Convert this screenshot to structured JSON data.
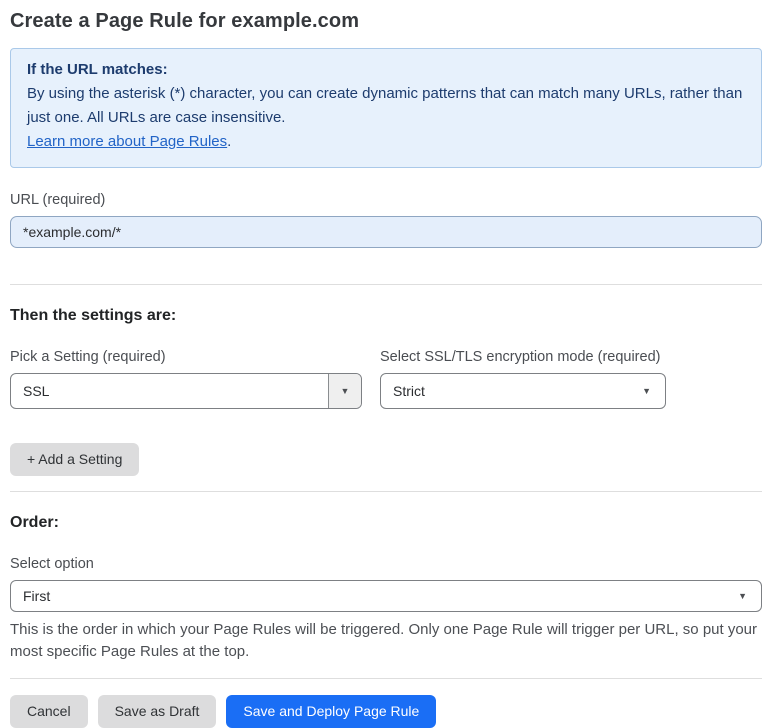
{
  "page": {
    "title": "Create a Page Rule for example.com"
  },
  "info_box": {
    "heading": "If the URL matches:",
    "body": "By using the asterisk (*) character, you can create dynamic patterns that can match many URLs, rather than just one. All URLs are case insensitive.",
    "link_label": "Learn more about Page Rules",
    "link_suffix": "."
  },
  "url_field": {
    "label": "URL (required)",
    "value": "*example.com/*"
  },
  "settings_section": {
    "heading": "Then the settings are:",
    "pick_setting": {
      "label": "Pick a Setting (required)",
      "selected_value": "SSL"
    },
    "encryption_mode": {
      "label": "Select SSL/TLS encryption mode (required)",
      "selected_value": "Strict"
    },
    "add_setting_button_label": "+ Add a Setting"
  },
  "order_section": {
    "heading": "Order:",
    "select_label": "Select option",
    "selected_value": "First",
    "help_text": "This is the order in which your Page Rules will be triggered. Only one Page Rule will trigger per URL, so put your most specific Page Rules at the top."
  },
  "footer": {
    "cancel_label": "Cancel",
    "save_draft_label": "Save as Draft",
    "save_deploy_label": "Save and Deploy Page Rule"
  },
  "icons": {
    "dropdown_caret": "▼"
  },
  "colors": {
    "accent_blue": "#1a6ef5",
    "info_box_bg": "#e7f1fc",
    "info_box_border": "#aac9e9",
    "info_text": "#1d3c6e",
    "link_blue": "#2264c7",
    "url_input_bg": "#e4eefb",
    "gray_button_bg": "#dcdcdd"
  }
}
